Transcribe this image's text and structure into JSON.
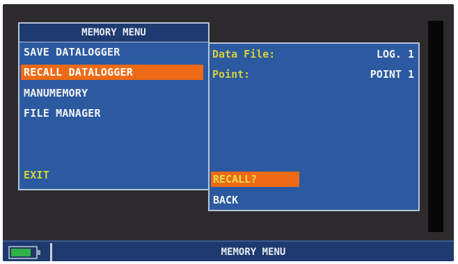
{
  "menu": {
    "title": "MEMORY MENU",
    "items": [
      {
        "label": "SAVE DATALOGGER",
        "selected": false
      },
      {
        "label": "RECALL DATALOGGER",
        "selected": true
      },
      {
        "label": "MANUMEMORY",
        "selected": false
      },
      {
        "label": "FILE MANAGER",
        "selected": false
      }
    ],
    "exit_label": "EXIT"
  },
  "detail": {
    "data_file_label": "Data File:",
    "data_file_value": "LOG. 1",
    "point_label": "Point:",
    "point_value": "POINT 1",
    "recall_label": "RECALL?",
    "back_label": "BACK"
  },
  "status": {
    "title": "MEMORY MENU",
    "battery_icon": "battery-icon",
    "battery_color": "#2fb24a"
  },
  "colors": {
    "panel_blue": "#2c5aa0",
    "header_blue": "#1e3a6e",
    "highlight_orange": "#ee6a14",
    "label_yellow": "#d8d03a"
  }
}
